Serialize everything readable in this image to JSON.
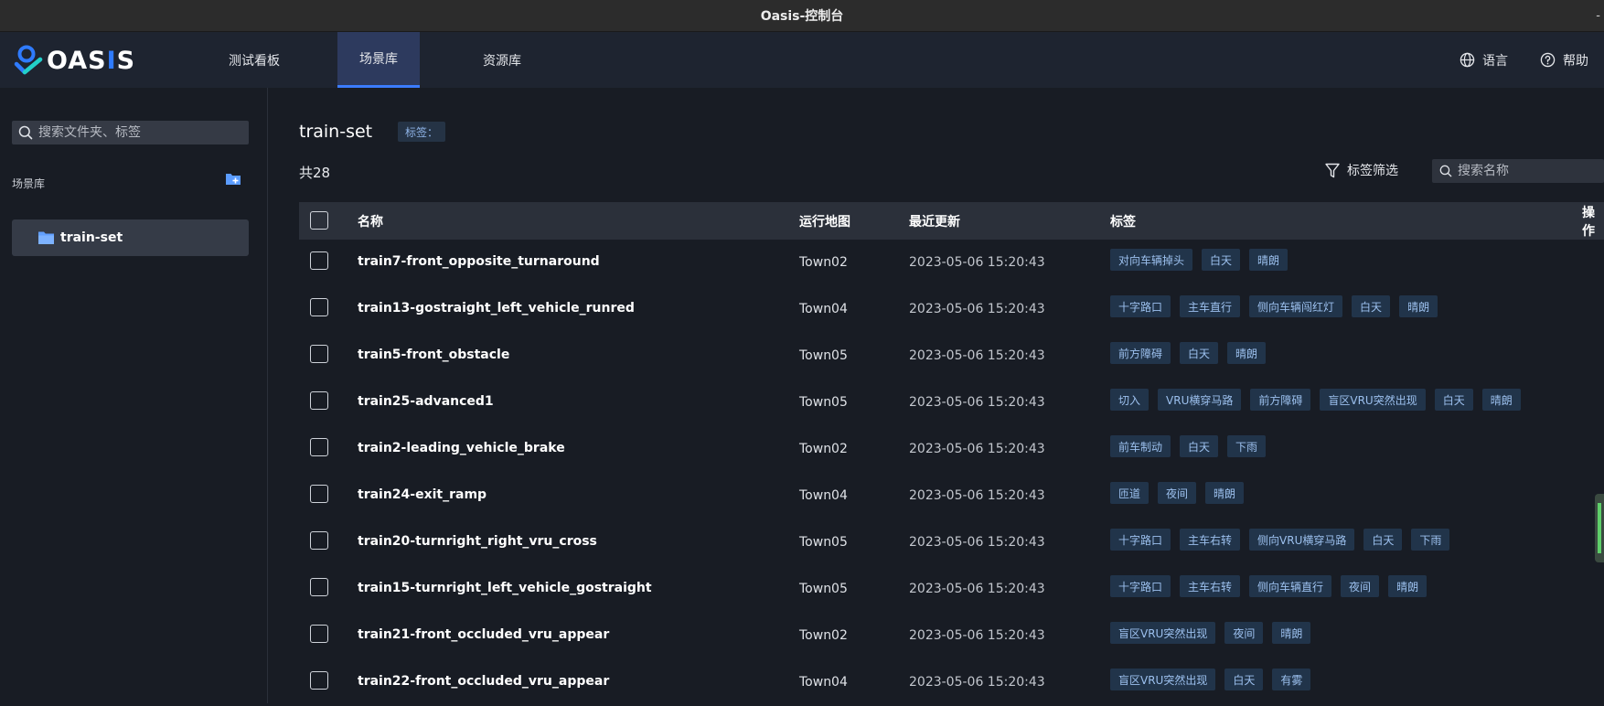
{
  "window": {
    "title": "Oasis-控制台",
    "corner_glyph": "-"
  },
  "brand": {
    "logo_text_a": "OAS",
    "logo_text_hl": "I",
    "logo_text_b": "S"
  },
  "nav": {
    "tabs": [
      {
        "label": "测试看板",
        "active": false
      },
      {
        "label": "场景库",
        "active": true
      },
      {
        "label": "资源库",
        "active": false
      }
    ],
    "language_label": "语言",
    "help_label": "帮助"
  },
  "sidebar": {
    "search_placeholder": "搜索文件夹、标签",
    "section_title": "场景库",
    "folders": [
      {
        "name": "train-set",
        "selected": true
      }
    ]
  },
  "main": {
    "title": "train-set",
    "tag_label": "标签：",
    "count_text": "共28",
    "filter_label": "标签筛选",
    "search_placeholder": "搜索名称",
    "columns": {
      "name": "名称",
      "map": "运行地图",
      "updated": "最近更新",
      "tags": "标签",
      "actions": "操作"
    },
    "rows": [
      {
        "name": "train7-front_opposite_turnaround",
        "map": "Town02",
        "updated": "2023-05-06 15:20:43",
        "tags": [
          "对向车辆掉头",
          "白天",
          "晴朗"
        ]
      },
      {
        "name": "train13-gostraight_left_vehicle_runred",
        "map": "Town04",
        "updated": "2023-05-06 15:20:43",
        "tags": [
          "十字路口",
          "主车直行",
          "侧向车辆闯红灯",
          "白天",
          "晴朗"
        ]
      },
      {
        "name": "train5-front_obstacle",
        "map": "Town05",
        "updated": "2023-05-06 15:20:43",
        "tags": [
          "前方障碍",
          "白天",
          "晴朗"
        ]
      },
      {
        "name": "train25-advanced1",
        "map": "Town05",
        "updated": "2023-05-06 15:20:43",
        "tags": [
          "切入",
          "VRU横穿马路",
          "前方障碍",
          "盲区VRU突然出现",
          "白天",
          "晴朗"
        ]
      },
      {
        "name": "train2-leading_vehicle_brake",
        "map": "Town02",
        "updated": "2023-05-06 15:20:43",
        "tags": [
          "前车制动",
          "白天",
          "下雨"
        ]
      },
      {
        "name": "train24-exit_ramp",
        "map": "Town04",
        "updated": "2023-05-06 15:20:43",
        "tags": [
          "匝道",
          "夜间",
          "晴朗"
        ]
      },
      {
        "name": "train20-turnright_right_vru_cross",
        "map": "Town05",
        "updated": "2023-05-06 15:20:43",
        "tags": [
          "十字路口",
          "主车右转",
          "侧向VRU横穿马路",
          "白天",
          "下雨"
        ]
      },
      {
        "name": "train15-turnright_left_vehicle_gostraight",
        "map": "Town05",
        "updated": "2023-05-06 15:20:43",
        "tags": [
          "十字路口",
          "主车右转",
          "侧向车辆直行",
          "夜间",
          "晴朗"
        ]
      },
      {
        "name": "train21-front_occluded_vru_appear",
        "map": "Town02",
        "updated": "2023-05-06 15:20:43",
        "tags": [
          "盲区VRU突然出现",
          "夜间",
          "晴朗"
        ]
      },
      {
        "name": "train22-front_occluded_vru_appear",
        "map": "Town04",
        "updated": "2023-05-06 15:20:43",
        "tags": [
          "盲区VRU突然出现",
          "白天",
          "有雾"
        ]
      }
    ]
  },
  "colors": {
    "accent": "#3b7cff",
    "chip_bg": "#21344a",
    "chip_text": "#9cc0ee",
    "nav_active_bg": "#2d3a5e"
  }
}
